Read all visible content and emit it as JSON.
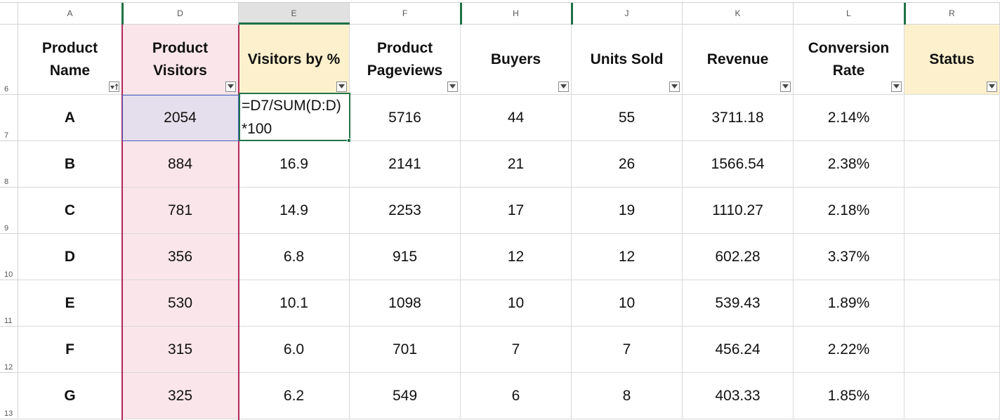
{
  "columns": [
    "A",
    "D",
    "E",
    "F",
    "H",
    "J",
    "K",
    "L",
    "R"
  ],
  "row_numbers": [
    "6",
    "7",
    "8",
    "9",
    "10",
    "11",
    "12",
    "13"
  ],
  "headers": {
    "product_name": "Product Name",
    "product_visitors": "Product Visitors",
    "visitors_pct": "Visitors by %",
    "product_pageviews": "Product Pageviews",
    "buyers": "Buyers",
    "units_sold": "Units Sold",
    "revenue": "Revenue",
    "conversion_rate": "Conversion Rate",
    "status": "Status"
  },
  "active_cell": {
    "ref": "E7",
    "formula": "=D7/SUM(D:D)\n*100"
  },
  "rows": [
    [
      "A",
      "2054",
      "",
      "5716",
      "44",
      "55",
      "3711.18",
      "2.14%",
      ""
    ],
    [
      "B",
      "884",
      "16.9",
      "2141",
      "21",
      "26",
      "1566.54",
      "2.38%",
      ""
    ],
    [
      "C",
      "781",
      "14.9",
      "2253",
      "17",
      "19",
      "1110.27",
      "2.18%",
      ""
    ],
    [
      "D",
      "356",
      "6.8",
      "915",
      "12",
      "12",
      "602.28",
      "3.37%",
      ""
    ],
    [
      "E",
      "530",
      "10.1",
      "1098",
      "10",
      "10",
      "539.43",
      "1.89%",
      ""
    ],
    [
      "F",
      "315",
      "6.0",
      "701",
      "7",
      "7",
      "456.24",
      "2.22%",
      ""
    ],
    [
      "G",
      "325",
      "6.2",
      "549",
      "6",
      "8",
      "403.33",
      "1.85%",
      ""
    ]
  ],
  "colors": {
    "pink_fill": "#fae5ea",
    "yellow_fill": "#fdf1cd",
    "selected_fill": "#e5deec",
    "active_border": "#227447",
    "column_border": "#b0275a"
  }
}
